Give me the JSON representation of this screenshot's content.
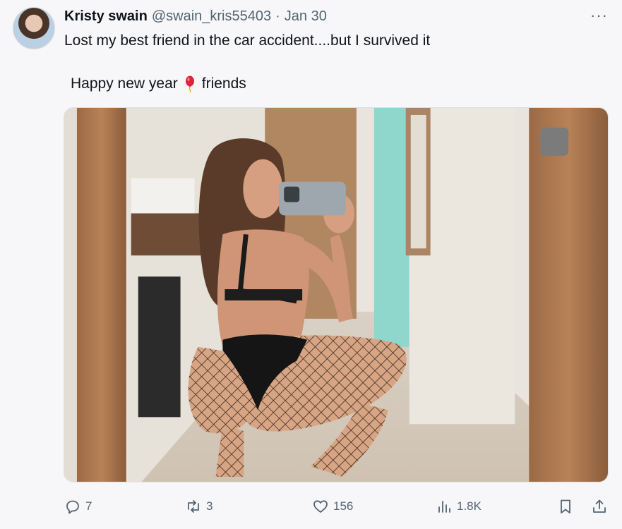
{
  "tweet": {
    "author_name": "Kristy swain",
    "handle": "@swain_kris55403",
    "separator": "·",
    "date": "Jan 30",
    "more_label": "···",
    "text_line1": "Lost my best friend in the car accident....but I survived it",
    "text_line2_before": "Happy new year",
    "text_line2_after": "friends",
    "emoji": "balloon-icon"
  },
  "actions": {
    "replies": "7",
    "reposts": "3",
    "likes": "156",
    "views": "1.8K"
  },
  "icons": {
    "reply": "reply-icon",
    "repost": "repost-icon",
    "like": "heart-icon",
    "views": "views-chart-icon",
    "bookmark": "bookmark-icon",
    "share": "share-icon"
  },
  "colors": {
    "text": "#0f1419",
    "muted": "#536471",
    "background": "#f7f7f9"
  }
}
